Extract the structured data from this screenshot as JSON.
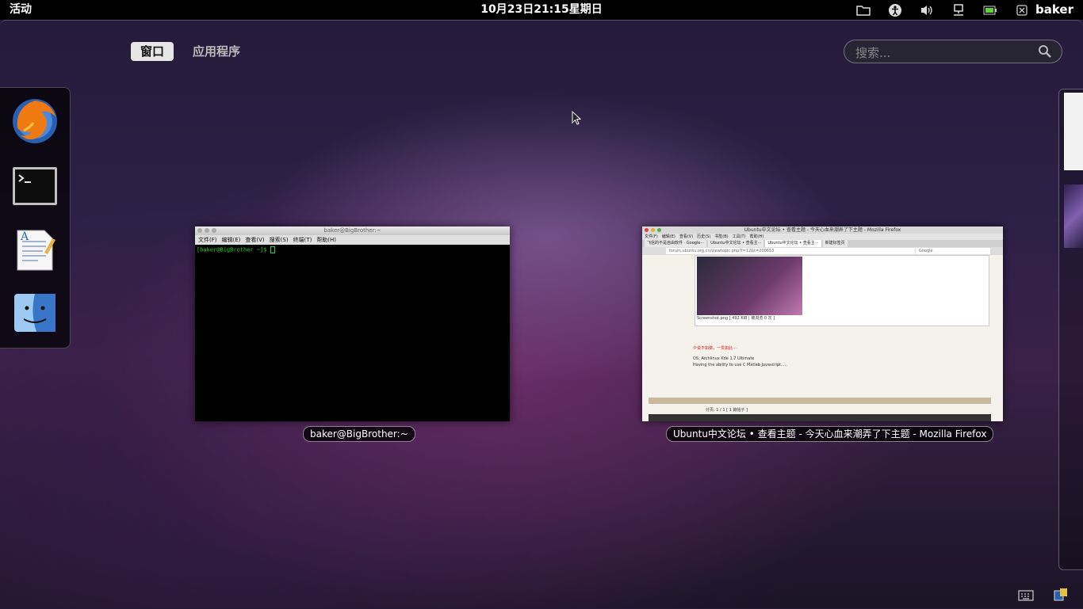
{
  "topbar": {
    "activities": "活动",
    "clock": "10月23日21:15星期日",
    "username": "baker",
    "indicators": [
      "folder-icon",
      "accessibility-icon",
      "volume-icon",
      "network-icon",
      "battery-icon",
      "user-status-icon"
    ]
  },
  "overview": {
    "tabs": [
      "窗口",
      "应用程序"
    ],
    "active_tab": "窗口",
    "search_placeholder": "搜索..."
  },
  "dash": {
    "apps": [
      "firefox",
      "terminal",
      "text-editor",
      "finder"
    ]
  },
  "windows": [
    {
      "caption": "baker@BigBrother:~",
      "title_bar": "baker@BigBrother:~",
      "menu": [
        "文件(F)",
        "编辑(E)",
        "查看(V)",
        "搜索(S)",
        "终端(T)",
        "帮助(H)"
      ],
      "prompt": "[baker@BigBrother ~]$"
    },
    {
      "caption": "Ubuntu中文论坛 • 查看主题 - 今天心血来潮弄了下主题 - Mozilla Firefox",
      "title_bar": "Ubuntu中文论坛 • 查看主题 - 今天心血来潮弄了下主题 - Mozilla Firefox",
      "menu": [
        "文件(F)",
        "编辑(E)",
        "查看(V)",
        "历史(S)",
        "书签(B)",
        "工具(T)",
        "帮助(H)"
      ],
      "tabs": [
        "飞信的不是自由软件 · Google···",
        "Ubuntu中文论坛 • 查看主···",
        "Ubuntu中文论坛 • 查看主···",
        "新建标签页"
      ],
      "url": "forum.ubuntu.org.cn/viewtopic.php?f=12&t=200653",
      "search_engine": "Google",
      "page_lines": [
        "Screenshot.png [ 492 KiB | 被浏览 0 次 ]",
        "少说不如做，一贯如此····",
        "OS:  Archlinux Kde 1.7 Ultimate",
        "Having the ability to use C Matlab Javascript.....",
        "分页: 1 / 1 [ 1 篇帖子 ]"
      ]
    }
  ],
  "colors": {
    "topbar": "#000000",
    "terminal_bg": "#000000",
    "prompt": "#2fd02f"
  }
}
